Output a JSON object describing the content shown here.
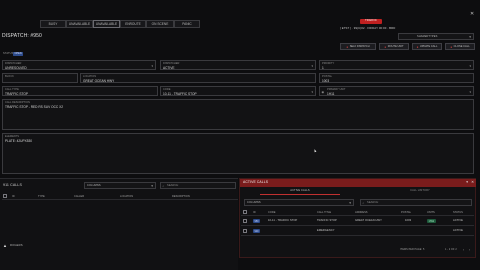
{
  "top_status": {
    "buttons": [
      "BUSY",
      "UNAVAILABLE",
      "UNAVAILABLE",
      "ENROUTE",
      "ON SCENE",
      "PANIC"
    ],
    "active_index": 2,
    "badge": "TRAFFIC",
    "status_line": "[ ETST ] · 99(C)#2 · FRIDAY 00:00 · BRD",
    "shared_types": "SHAREDTYPES"
  },
  "dispatch": {
    "title": "DISPATCH: #950",
    "status_label": "STATUS",
    "status_value": "OPEN",
    "fields": {
      "dispatcher": {
        "label": "DISPATCHER",
        "value": "UNRESOLVED"
      },
      "dispatcher2": {
        "label": "DISPATCHER",
        "value": "ACTIVE"
      },
      "priority": {
        "label": "PRIORITY",
        "value": "1"
      },
      "block": {
        "label": "BLOCK",
        "value": ""
      },
      "location": {
        "label": "LOCATION",
        "value": "GREAT OCEAN HWY"
      },
      "postal": {
        "label": "POSTAL",
        "value": "1003"
      },
      "call_type": {
        "label": "CALL TYPE",
        "value": "TRAFFIC STOP"
      },
      "code": {
        "label": "CODE",
        "value": "10-11 - TRAFFIC STOP"
      },
      "primary_unit": {
        "label": "PRIMARY UNIT",
        "value": "1H11"
      },
      "description": {
        "label": "CALL DESCRIPTION",
        "value": "TRAFFIC STOP - RED RS SUV OCC X2"
      },
      "plate": {
        "label": "ELEMENTS",
        "value": "PLATE: 42UPX530"
      }
    },
    "actions": [
      "SELF DISPATCH",
      "ROUTE UNIT",
      "UPDATE CALL",
      "CLOSE CALL"
    ]
  },
  "calls_911": {
    "title": "911 CALLS",
    "columns_label": "COLUMNS",
    "search_placeholder": "SEARCH",
    "headers": [
      "ID",
      "TYPE",
      "CALLER",
      "LOCATION",
      "DESCRIPTION"
    ],
    "footer_label": "ROGERS"
  },
  "active_calls": {
    "title": "ACTIVE CALLS",
    "tabs": [
      "ACTIVE CALLS",
      "CALL HISTORY"
    ],
    "columns_label": "COLUMNS",
    "search_placeholder": "SEARCH",
    "headers": [
      "ID",
      "CODE",
      "CALL TITLE",
      "ADDRESS",
      "POSTAL",
      "UNITS",
      "STATUS"
    ],
    "rows": [
      {
        "id": "950",
        "code": "10-11 - TRAFFIC STOP",
        "title": "TRAFFIC STOP",
        "address": "GREAT OCEAN HWY",
        "postal": "1003",
        "units": "1H11",
        "status": "ACTIVE"
      },
      {
        "id": "949",
        "code": "",
        "title": "EMERGENCY",
        "address": "",
        "postal": "",
        "units": "",
        "status": "ACTIVE"
      }
    ],
    "pagination": "ITEMS PER PAGE: 5",
    "page_range": "1 - 2 OF 2"
  },
  "colors": {
    "accent_red": "#7a1c1c",
    "badge_red": "#c02020",
    "code_blue": "#2c4a8a",
    "unit_green": "#1f5a3c"
  }
}
